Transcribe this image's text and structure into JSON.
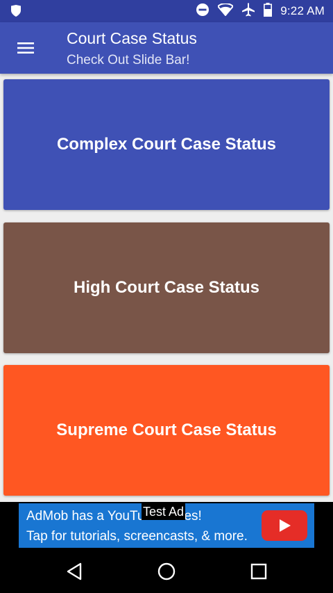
{
  "status_bar": {
    "time": "9:22 AM",
    "icons": [
      "shield-icon",
      "do-not-disturb-icon",
      "wifi-icon",
      "airplane-icon",
      "battery-icon"
    ]
  },
  "app_bar": {
    "menu_icon": "hamburger-menu-icon",
    "title": "Court Case Status",
    "subtitle": "Check Out Slide Bar!"
  },
  "cards": [
    {
      "label": "Complex Court Case Status",
      "color": "#3f51b5"
    },
    {
      "label": "High Court Case Status",
      "color": "#795548"
    },
    {
      "label": "Supreme Court Case Status",
      "color": "#ff5722"
    }
  ],
  "ad": {
    "line1": "AdMob has a YouTube series!",
    "line2": "Tap for tutorials, screencasts, & more.",
    "badge": "Test Ad",
    "play_icon": "youtube-play-icon"
  },
  "nav_bar": {
    "icons": [
      "back-icon",
      "home-icon",
      "recents-icon"
    ]
  }
}
